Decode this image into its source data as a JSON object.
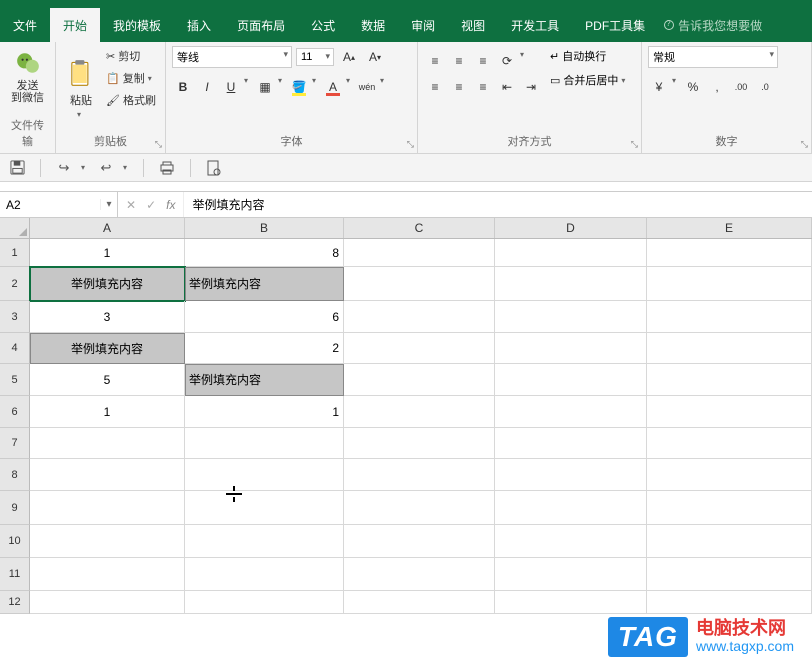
{
  "menu": {
    "file": "文件",
    "home": "开始",
    "templates": "我的模板",
    "insert": "插入",
    "layout": "页面布局",
    "formulas": "公式",
    "data": "数据",
    "review": "审阅",
    "view": "视图",
    "dev": "开发工具",
    "pdf": "PDF工具集",
    "tell": "告诉我您想要做"
  },
  "ribbon": {
    "send_wechat": "发送\n到微信",
    "filetransfer": "文件传输",
    "paste": "粘贴",
    "cut": "剪切",
    "copy": "复制",
    "format_painter": "格式刷",
    "clipboard": "剪贴板",
    "font_name": "等线",
    "font_size": "11",
    "bold": "B",
    "italic": "I",
    "underline": "U",
    "ruby": "wén",
    "font_group": "字体",
    "wrap": "自动换行",
    "merge": "合并后居中",
    "align_group": "对齐方式",
    "number_format": "常规",
    "number_group": "数字"
  },
  "namebox": "A2",
  "formula": "举例填充内容",
  "columns": {
    "A": "A",
    "B": "B",
    "C": "C",
    "D": "D",
    "E": "E"
  },
  "rows": [
    "1",
    "2",
    "3",
    "4",
    "5",
    "6",
    "7",
    "8",
    "9",
    "10",
    "11",
    "12"
  ],
  "cells": {
    "A1": "1",
    "B1": "8",
    "A2": "举例填充内容",
    "B2": "举例填充内容",
    "A3": "3",
    "B3": "6",
    "A4": "举例填充内容",
    "B4": "2",
    "A5": "5",
    "B5": "举例填充内容",
    "A6": "1",
    "B6": "1"
  },
  "watermark": {
    "tag": "TAG",
    "cn": "电脑技术网",
    "url": "www.tagxp.com"
  },
  "chart_data": {
    "type": "table",
    "columns": [
      "A",
      "B"
    ],
    "rows": [
      [
        "1",
        "8"
      ],
      [
        "举例填充内容",
        "举例填充内容"
      ],
      [
        "3",
        "6"
      ],
      [
        "举例填充内容",
        "2"
      ],
      [
        "5",
        "举例填充内容"
      ],
      [
        "1",
        "1"
      ]
    ]
  }
}
